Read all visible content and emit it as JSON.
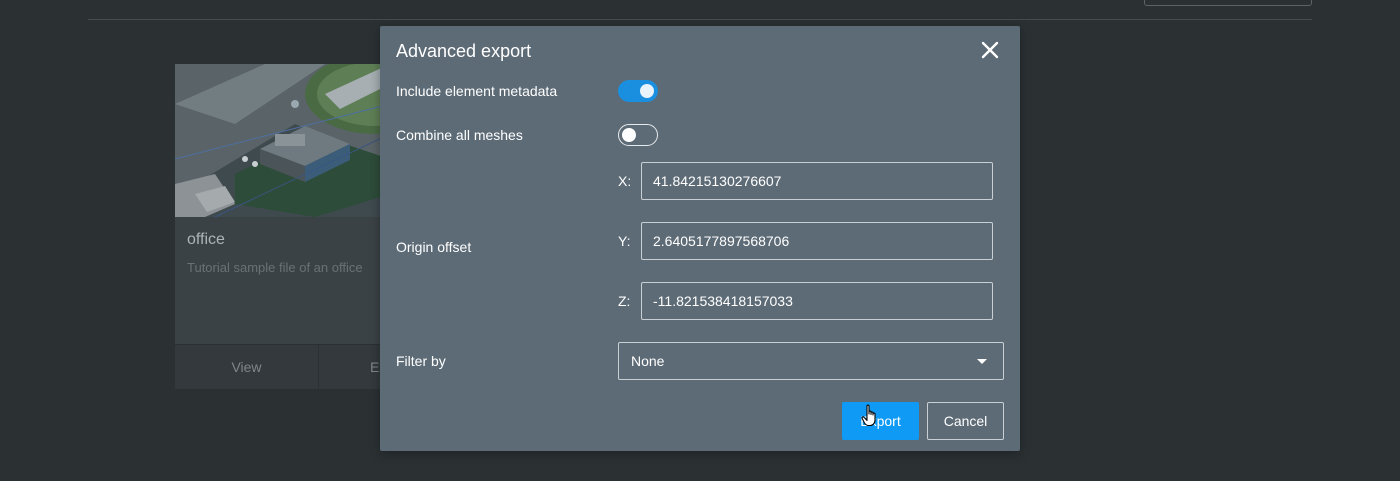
{
  "background": {
    "card": {
      "title": "office",
      "description": "Tutorial sample file of an office",
      "view_label": "View",
      "export_label": "Export"
    }
  },
  "dialog": {
    "title": "Advanced export",
    "close_icon": "close-icon",
    "include_metadata": {
      "label": "Include element metadata",
      "on": true
    },
    "combine_meshes": {
      "label": "Combine all meshes",
      "on": false
    },
    "origin_offset": {
      "label": "Origin offset",
      "x_label": "X:",
      "x_value": "41.84215130276607",
      "y_label": "Y:",
      "y_value": "2.6405177897568706",
      "z_label": "Z:",
      "z_value": "-11.821538418157033"
    },
    "filter_by": {
      "label": "Filter by",
      "selected": "None"
    },
    "export_label": "Export",
    "cancel_label": "Cancel"
  },
  "colors": {
    "dialog_bg": "#5d6b76",
    "accent": "#0f9bf5",
    "toggle_on": "#1a8fe0",
    "page_bg": "#2b3133"
  }
}
